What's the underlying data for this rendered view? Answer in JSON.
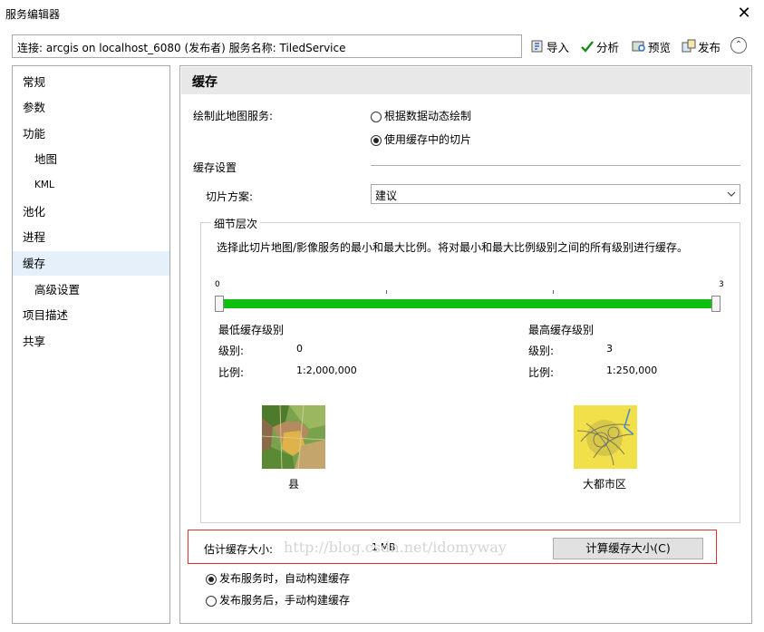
{
  "window": {
    "title": "服务编辑器",
    "close_label": "✕"
  },
  "connection": {
    "text": "连接: arcgis on localhost_6080 (发布者)    服务名称: TiledService"
  },
  "toolbar": {
    "import_label": "导入",
    "analyze_label": "分析",
    "preview_label": "预览",
    "publish_label": "发布",
    "collapse_symbol": "⌃"
  },
  "sidebar": {
    "items": [
      {
        "label": "常规"
      },
      {
        "label": "参数"
      },
      {
        "label": "功能"
      },
      {
        "label": "地图"
      },
      {
        "label": "KML"
      },
      {
        "label": "池化"
      },
      {
        "label": "进程"
      },
      {
        "label": "缓存"
      },
      {
        "label": "高级设置"
      },
      {
        "label": "项目描述"
      },
      {
        "label": "共享"
      }
    ]
  },
  "main": {
    "header": "缓存",
    "draw_label": "绘制此地图服务:",
    "draw_options": [
      {
        "label": "根据数据动态绘制",
        "selected": false
      },
      {
        "label": "使用缓存中的切片",
        "selected": true
      }
    ],
    "cache_settings_label": "缓存设置",
    "tiling_scheme_label": "切片方案:",
    "tiling_scheme_value": "建议",
    "lod": {
      "title": "细节层次",
      "description": "选择此切片地图/影像服务的最小和最大比例。将对最小和最大比例级别之间的所有级别进行缓存。",
      "slider_min_label": "0",
      "slider_max_label": "3",
      "min_fraction": 0,
      "max_fraction": 1,
      "min": {
        "title": "最低缓存级别",
        "level_label": "级别:",
        "level_value": "0",
        "scale_label": "比例:",
        "scale_value": "1:2,000,000",
        "map_caption": "县"
      },
      "max": {
        "title": "最高缓存级别",
        "level_label": "级别:",
        "level_value": "3",
        "scale_label": "比例:",
        "scale_value": "1:250,000",
        "map_caption": "大都市区"
      }
    },
    "estimate": {
      "label": "估计缓存大小:",
      "value": "1 MB",
      "button_label": "计算缓存大小(C)"
    },
    "build_options": [
      {
        "label": "发布服务时，自动构建缓存",
        "selected": true
      },
      {
        "label": "发布服务后，手动构建缓存",
        "selected": false
      }
    ]
  },
  "watermark": "http://blog.csdn.net/idomyway",
  "colors": {
    "slider_fill": "#10c010",
    "highlight_border": "#e03030",
    "selected_item": "#e5f0fa"
  }
}
